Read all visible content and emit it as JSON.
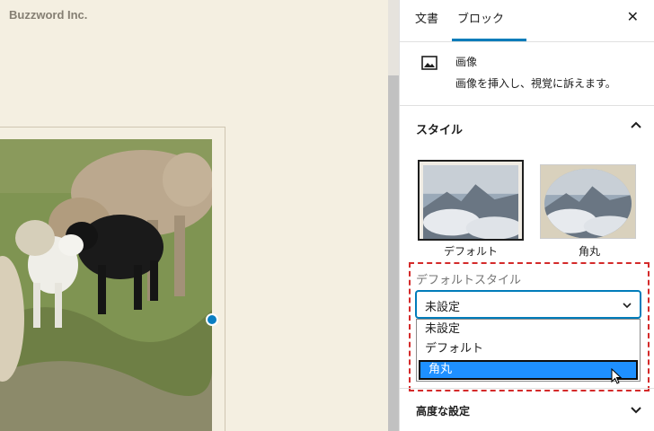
{
  "canvas": {
    "site_title": "Buzzword Inc."
  },
  "sidebar": {
    "tabs": [
      {
        "label": "文書"
      },
      {
        "label": "ブロック"
      }
    ],
    "close_icon": "close-icon",
    "block": {
      "icon": "image-icon",
      "name": "画像",
      "description": "画像を挿入し、視覚に訴えます。"
    },
    "styles_panel": {
      "title": "スタイル",
      "options": [
        {
          "label": "デフォルト",
          "selected": true
        },
        {
          "label": "角丸",
          "selected": false
        }
      ],
      "default_style_label": "デフォルトスタイル",
      "select": {
        "value": "未設定",
        "options": [
          "未設定",
          "デフォルト",
          "角丸"
        ],
        "hovered_option": "角丸"
      }
    },
    "advanced_panel": {
      "title": "高度な設定"
    }
  },
  "colors": {
    "accent": "#007cba",
    "canvas_bg": "#f4efe1",
    "highlight": "#1e90ff",
    "annotation": "#d42a2a"
  }
}
